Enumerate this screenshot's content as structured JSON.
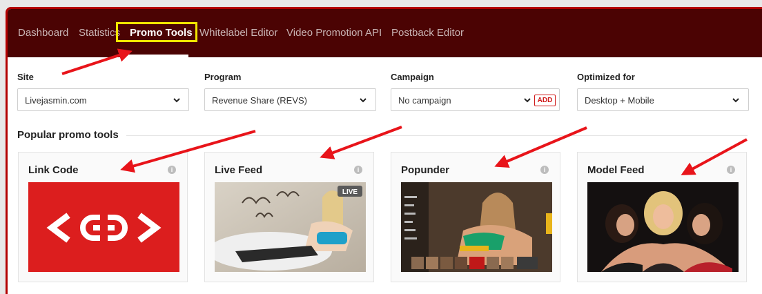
{
  "nav": {
    "items": [
      "Dashboard",
      "Statistics",
      "Promo Tools",
      "Whitelabel Editor",
      "Video Promotion API",
      "Postback Editor"
    ],
    "active_index": 2
  },
  "filters": {
    "site": {
      "label": "Site",
      "value": "Livejasmin.com"
    },
    "program": {
      "label": "Program",
      "value": "Revenue Share (REVS)"
    },
    "campaign": {
      "label": "Campaign",
      "value": "No campaign",
      "add_label": "ADD"
    },
    "optimized": {
      "label": "Optimized for",
      "value": "Desktop + Mobile"
    }
  },
  "section": {
    "title": "Popular promo tools"
  },
  "cards": [
    {
      "title": "Link Code",
      "info_icon": "info-icon",
      "thumb": "link-code-logo"
    },
    {
      "title": "Live Feed",
      "info_icon": "info-icon",
      "thumb": "live-feed-image",
      "badge": "LIVE"
    },
    {
      "title": "Popunder",
      "info_icon": "info-icon",
      "thumb": "popunder-image"
    },
    {
      "title": "Model Feed",
      "info_icon": "info-icon",
      "thumb": "model-feed-image"
    }
  ],
  "colors": {
    "nav_bg": "#4b0303",
    "frame_border": "#b30000",
    "highlight": "#f1e600",
    "annotation_arrow": "#e8141a",
    "link_code_bg": "#dc1e1e"
  }
}
